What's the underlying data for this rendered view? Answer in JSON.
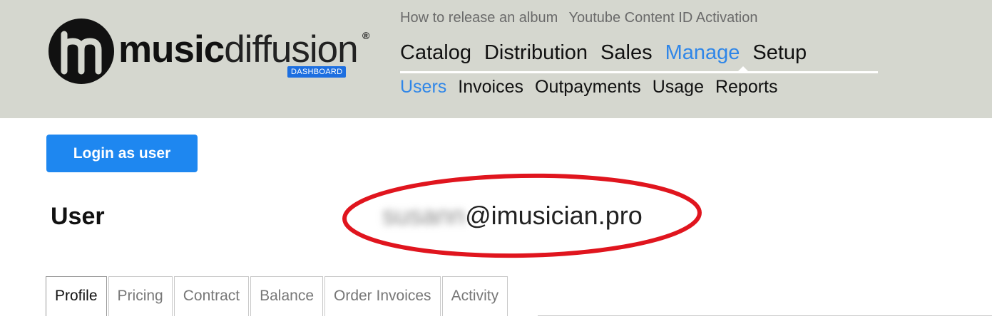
{
  "app": {
    "logo_word_bold": "music",
    "logo_word_light": "diffusion",
    "logo_registered": "®",
    "logo_badge": "DASHBOARD"
  },
  "top_links": [
    "How to release an album",
    "Youtube Content ID Activation"
  ],
  "main_nav": [
    {
      "label": "Catalog",
      "active": false
    },
    {
      "label": "Distribution",
      "active": false
    },
    {
      "label": "Sales",
      "active": false
    },
    {
      "label": "Manage",
      "active": true
    },
    {
      "label": "Setup",
      "active": false
    }
  ],
  "sub_nav": [
    {
      "label": "Users",
      "active": true
    },
    {
      "label": "Invoices",
      "active": false
    },
    {
      "label": "Outpayments",
      "active": false
    },
    {
      "label": "Usage",
      "active": false
    },
    {
      "label": "Reports",
      "active": false
    }
  ],
  "actions": {
    "login_as_user": "Login as user"
  },
  "user": {
    "heading": "User",
    "email_hidden_part": "susann",
    "email_domain": "@imusician.pro"
  },
  "tabs": [
    {
      "label": "Profile",
      "active": true
    },
    {
      "label": "Pricing",
      "active": false
    },
    {
      "label": "Contract",
      "active": false
    },
    {
      "label": "Balance",
      "active": false
    },
    {
      "label": "Order Invoices",
      "active": false
    },
    {
      "label": "Activity",
      "active": false
    }
  ],
  "colors": {
    "header_bg": "#d5d7cf",
    "accent": "#2f86e8",
    "button": "#1e87f0",
    "highlight_ellipse": "#e0151e"
  },
  "icons": {
    "logo_mark": "m-circle-logo-icon"
  }
}
